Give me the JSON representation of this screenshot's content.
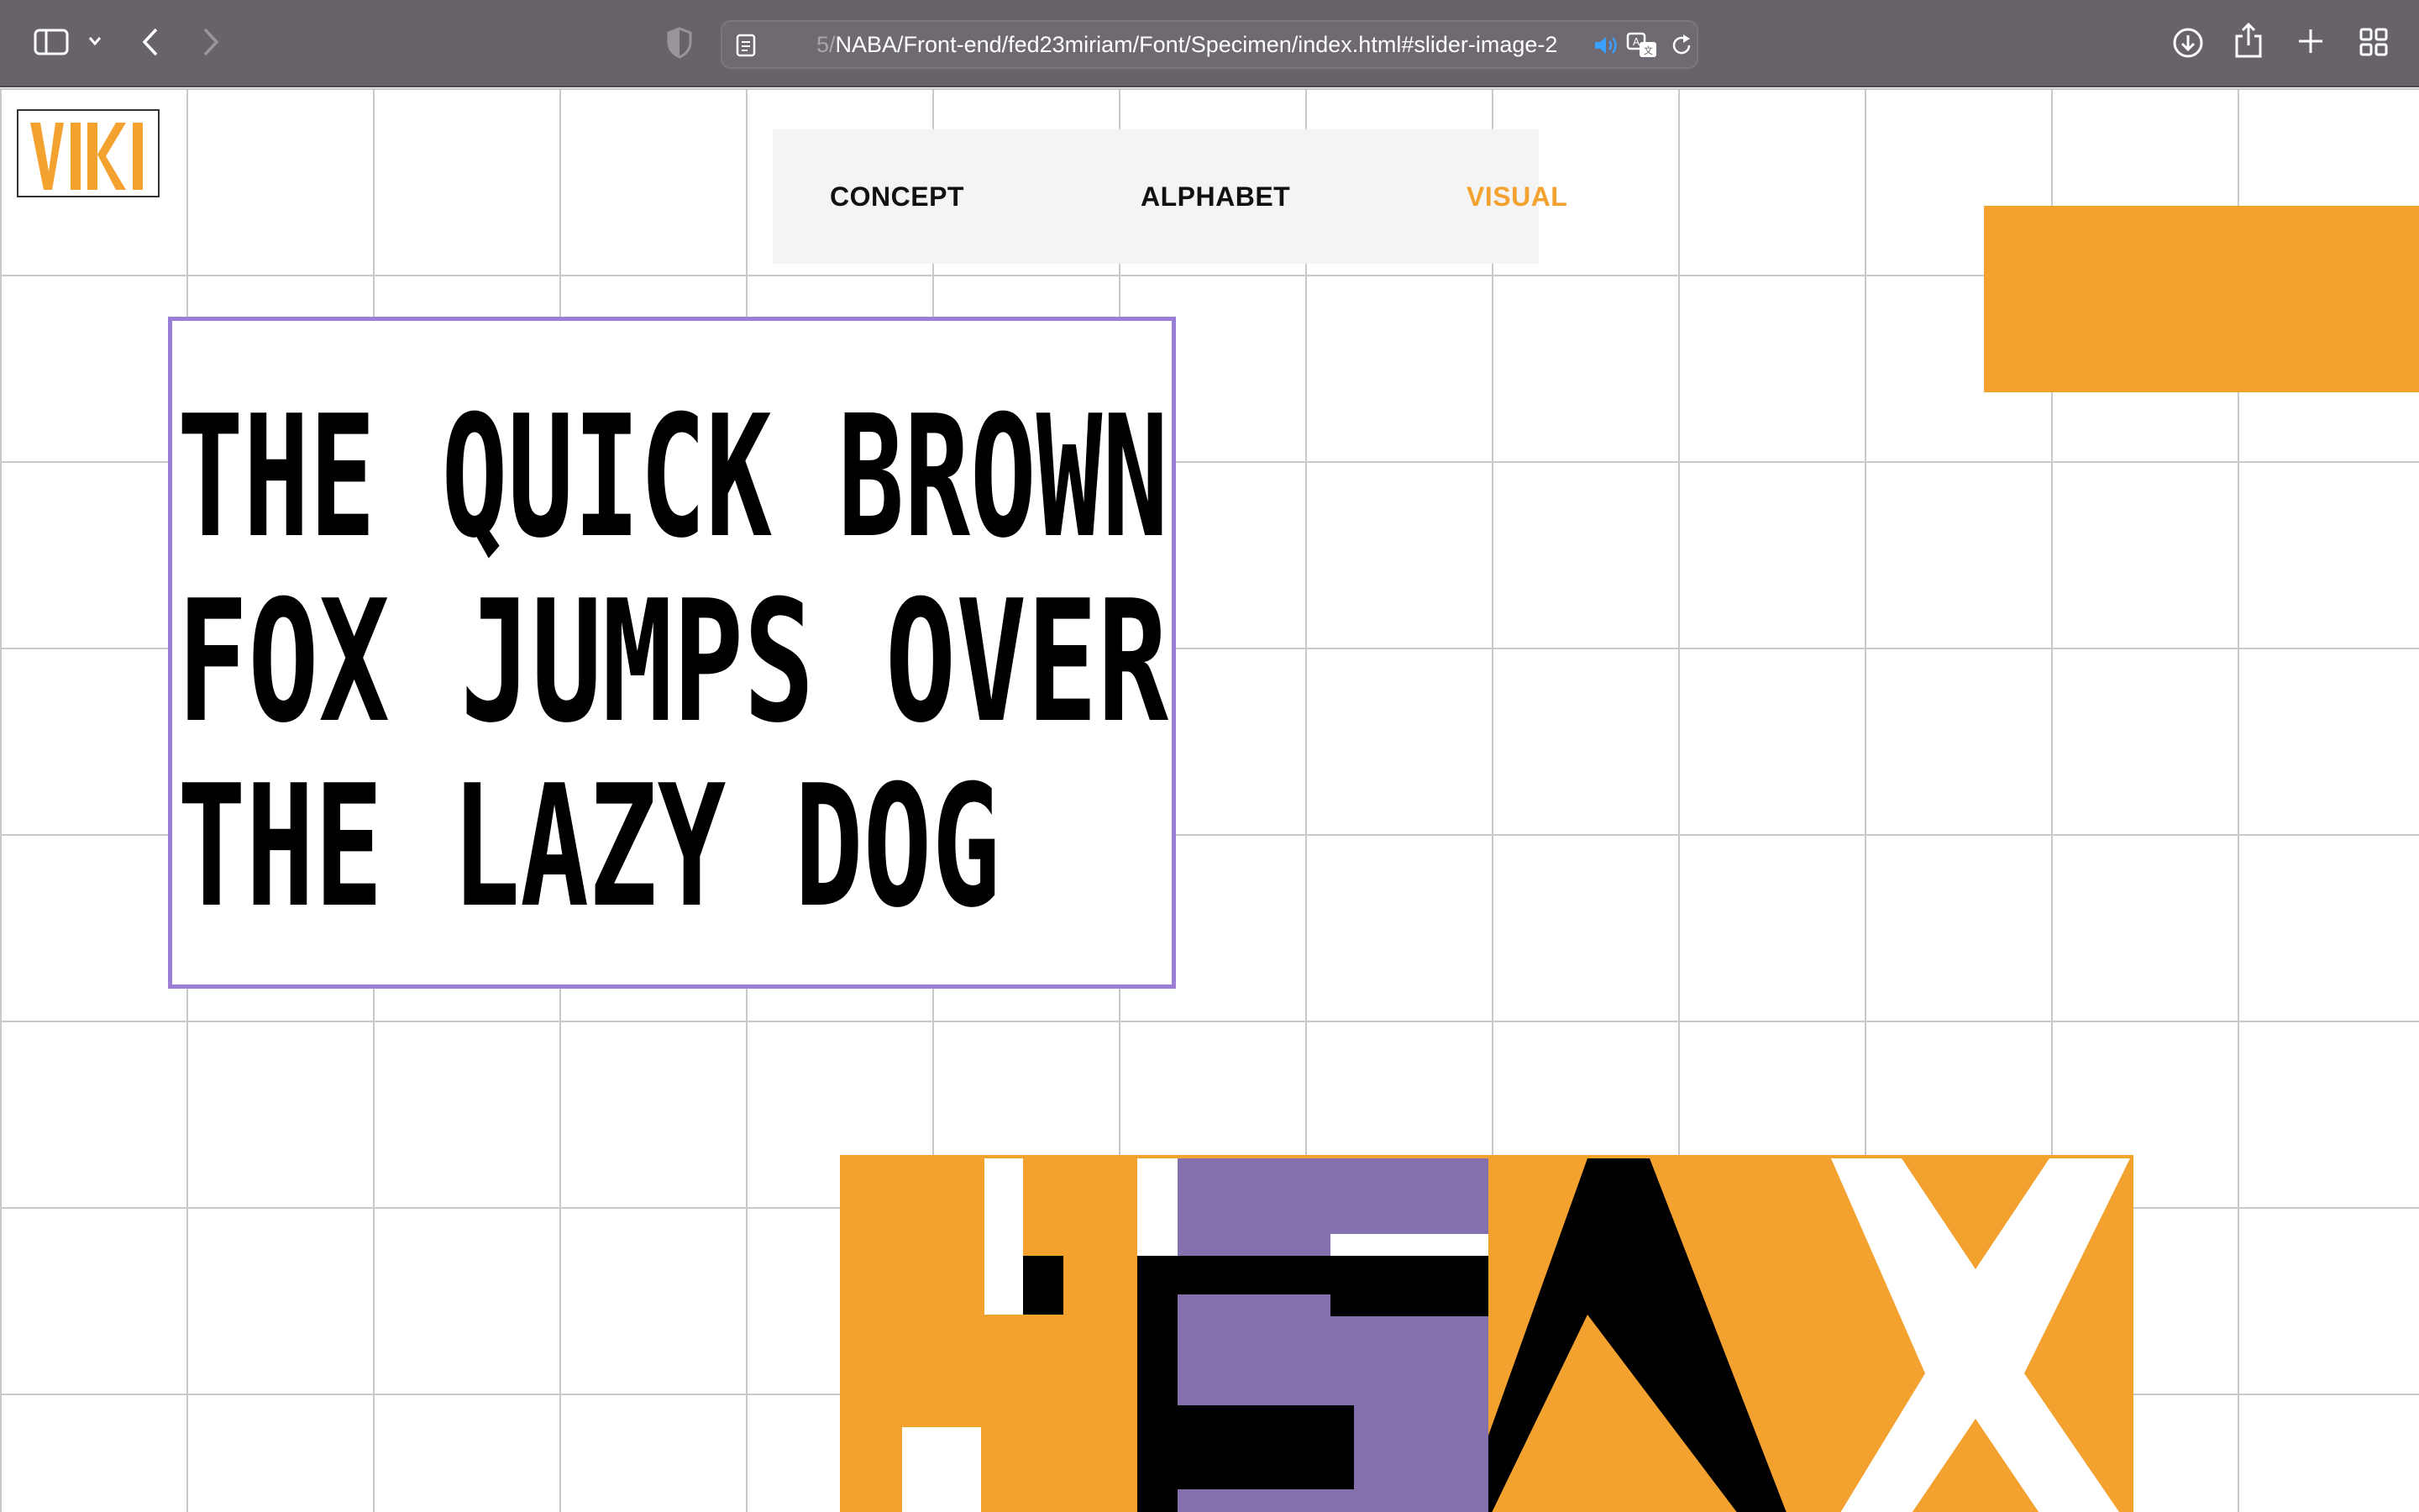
{
  "browser": {
    "url_prefix": "5/",
    "url_main": "NABA/Front-end/fed23miriam/Font/Specimen/index.html#slider-image-2",
    "icons": [
      "sidebar-icon",
      "chevron-down-icon",
      "back-icon",
      "forward-icon",
      "privacy-shield-icon",
      "reader-page-icon",
      "audio-icon",
      "translate-icon",
      "reload-icon",
      "download-icon",
      "share-icon",
      "plus-icon",
      "tabs-grid-icon"
    ]
  },
  "logo": {
    "text": "VIKI"
  },
  "nav": {
    "items": [
      {
        "label": "CONCEPT"
      },
      {
        "label": "ALPHABET"
      },
      {
        "label": "VISUAL"
      }
    ],
    "active_color": "#f4a22f"
  },
  "specimen": {
    "lines": [
      "THE QUICK BROWN",
      "FOX JUMPS OVER",
      "THE LAZY DOG"
    ],
    "border_color": "#9b7fd6"
  },
  "colors": {
    "accent": "#f4a22f",
    "purple": "#8470ad",
    "grid": "#c9c9c9"
  }
}
